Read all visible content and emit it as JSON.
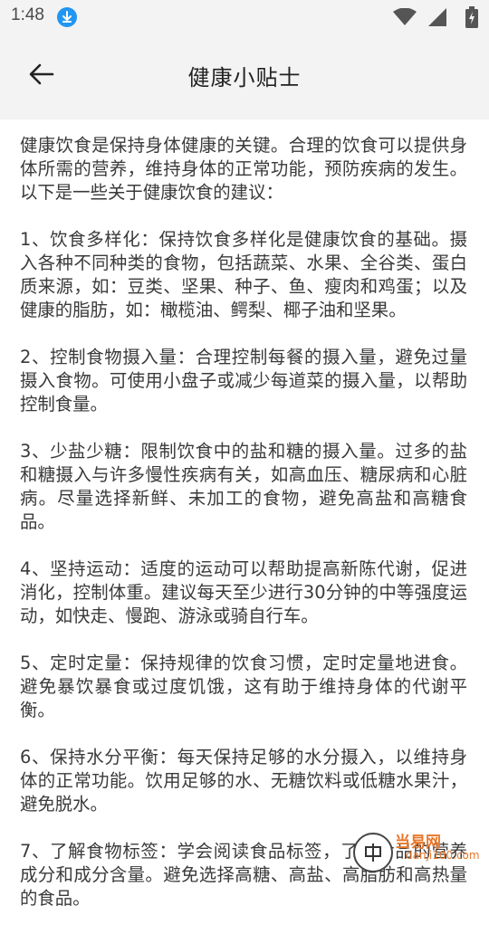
{
  "status_bar": {
    "time": "1:48",
    "icons": [
      "download-icon",
      "wifi-icon",
      "signal-icon",
      "battery-icon"
    ]
  },
  "header": {
    "title": "健康小贴士",
    "back_icon": "arrow-left-icon"
  },
  "article": {
    "paragraphs": [
      "健康饮食是保持身体健康的关键。合理的饮食可以提供身体所需的营养，维持身体的正常功能，预防疾病的发生。以下是一些关于健康饮食的建议：",
      " 1、饮食多样化：保持饮食多样化是健康饮食的基础。摄入各种不同种类的食物，包括蔬菜、水果、全谷类、蛋白质来源，如：豆类、坚果、种子、鱼、瘦肉和鸡蛋；以及健康的脂肪，如：橄榄油、鳄梨、椰子油和坚果。",
      " 2、控制食物摄入量：合理控制每餐的摄入量，避免过量摄入食物。可使用小盘子或减少每道菜的摄入量，以帮助控制食量。",
      " 3、少盐少糖：限制饮食中的盐和糖的摄入量。过多的盐和糖摄入与许多慢性疾病有关，如高血压、糖尿病和心脏病。尽量选择新鲜、未加工的食物，避免高盐和高糖食品。",
      " 4、坚持运动：适度的运动可以帮助提高新陈代谢，促进消化，控制体重。建议每天至少进行30分钟的中等强度运动，如快走、慢跑、游泳或骑自行车。",
      " 5、定时定量：保持规律的饮食习惯，定时定量地进食。避免暴饮暴食或过度饥饿，这有助于维持身体的代谢平衡。",
      " 6、保持水分平衡：每天保持足够的水分摄入，以维持身体的正常功能。饮用足够的水、无糖饮料或低糖水果汁，避免脱水。",
      " 7、了解食物标签：学会阅读食品标签，了解食品的营养成分和成分含量。避免选择高糖、高盐、高脂肪和高热量的食品。"
    ]
  },
  "watermark": {
    "line1": "当易网",
    "line2": "danji100.com"
  },
  "colors": {
    "bar_background": "#f3f3f3",
    "download_icon": "#2196f3",
    "watermark": "#e8782a"
  }
}
